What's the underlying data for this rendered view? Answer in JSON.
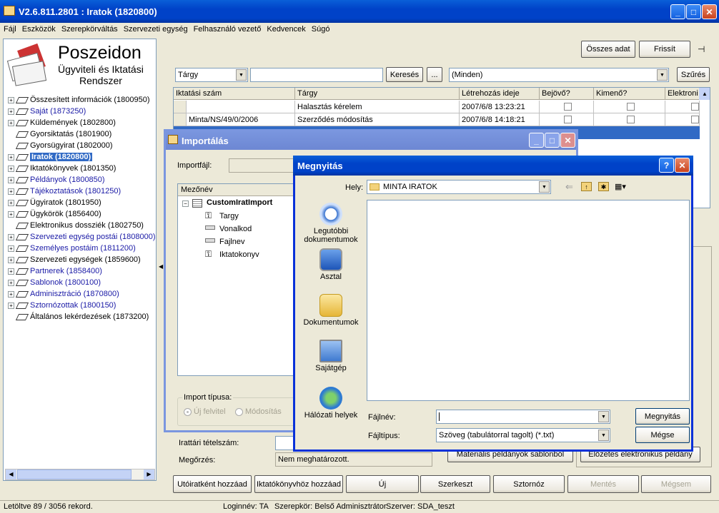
{
  "app": {
    "title": "V2.6.811.2801 : Iratok (1820800)"
  },
  "menu": [
    "Fájl",
    "Eszközök",
    "Szerepkörváltás",
    "Szervezeti egység",
    "Felhasználó vezető",
    "Kedvencek",
    "Súgó"
  ],
  "logo": {
    "line1": "Poszeidon",
    "line2": "Ügyviteli és Iktatási",
    "line3": "Rendszer"
  },
  "tree": [
    {
      "label": "Összesített információk (1800950)",
      "pm": "+",
      "blue": false
    },
    {
      "label": "Saját (1873250)",
      "pm": "+",
      "blue": true
    },
    {
      "label": "Küldemények (1802800)",
      "pm": "+",
      "blue": false
    },
    {
      "label": "Gyorsiktatás (1801900)",
      "pm": "",
      "blue": false
    },
    {
      "label": "Gyorsügyirat (1802000)",
      "pm": "",
      "blue": false
    },
    {
      "label": "Iratok (1820800)",
      "pm": "+",
      "blue": false,
      "selected": true
    },
    {
      "label": "Iktatókönyvek (1801350)",
      "pm": "+",
      "blue": false
    },
    {
      "label": "Példányok (1800850)",
      "pm": "+",
      "blue": true
    },
    {
      "label": "Tájékoztatások (1801250)",
      "pm": "+",
      "blue": true
    },
    {
      "label": "Ügyiratok (1801950)",
      "pm": "+",
      "blue": false
    },
    {
      "label": "Ügykörök (1856400)",
      "pm": "+",
      "blue": false
    },
    {
      "label": "Elektronikus dossziék (1802750)",
      "pm": "",
      "blue": false
    },
    {
      "label": "Szervezeti egység postái (1808000)",
      "pm": "+",
      "blue": true
    },
    {
      "label": "Személyes postáim (1811200)",
      "pm": "+",
      "blue": true
    },
    {
      "label": "Szervezeti egységek (1859600)",
      "pm": "+",
      "blue": false
    },
    {
      "label": "Partnerek (1858400)",
      "pm": "+",
      "blue": true
    },
    {
      "label": "Sablonok (1800100)",
      "pm": "+",
      "blue": true
    },
    {
      "label": "Adminisztráció (1870800)",
      "pm": "+",
      "blue": true
    },
    {
      "label": "Sztornózottak (1800150)",
      "pm": "+",
      "blue": true
    },
    {
      "label": "Általános lekérdezések (1873200)",
      "pm": "",
      "blue": false
    }
  ],
  "topbar": {
    "all_data": "Összes adat",
    "refresh": "Frissít"
  },
  "search": {
    "field": "Tárgy",
    "value": "",
    "search_btn": "Keresés",
    "more_btn": "...",
    "filter_value": "(Minden)",
    "filter_btn": "Szűrés"
  },
  "grid": {
    "headers": [
      "Iktatási szám",
      "Tárgy",
      "Létrehozás ideje",
      "Bejövő?",
      "Kimenő?",
      "Elektroni"
    ],
    "rows": [
      {
        "iktatasi": "",
        "targy": "Halasztás kérelem",
        "ido": "2007/6/8 13:23:21"
      },
      {
        "iktatasi": "Minta/NS/49/0/2006",
        "targy": "Szerződés módosítás",
        "ido": "2007/6/8 14:18:21"
      }
    ]
  },
  "bottom": {
    "irattari_label": "Irattári tételszám:",
    "megorzes_label": "Megőrzés:",
    "megorzes_value": "Nem meghatározott.",
    "materialis": "Materiális példányok sablonból",
    "elozetes": "Előzetes elektronikus példány",
    "buttons": [
      {
        "label": "Utóiratként hozzáad",
        "enabled": true
      },
      {
        "label": "Iktatókönyvhöz hozzáad",
        "enabled": true
      },
      {
        "label": "Új",
        "enabled": true
      },
      {
        "label": "Szerkeszt",
        "enabled": true
      },
      {
        "label": "Sztornóz",
        "enabled": true
      },
      {
        "label": "Mentés",
        "enabled": false
      },
      {
        "label": "Mégsem",
        "enabled": false
      }
    ]
  },
  "status": {
    "records": "Letöltve 89 / 3056 rekord.",
    "login": "Loginnév: TA",
    "role": "Szerepkör: Belső Adminisztrátor",
    "server": "Szerver: SDA_teszt"
  },
  "import_dialog": {
    "title": "Importálás",
    "file_label": "Importfájl:",
    "col_header": "Mezőnév",
    "root": "CustomIratImport",
    "children": [
      "Targy",
      "Vonalkod",
      "Fajlnev",
      "Iktatokonyv"
    ],
    "type_label": "Import típusa:",
    "opt_new": "Új felvitel",
    "opt_mod": "Módosítás"
  },
  "open_dialog": {
    "title": "Megnyitás",
    "location_label": "Hely:",
    "location_value": "MINTA IRATOK",
    "places": [
      {
        "label": "Legutóbbi dokumentumok",
        "icon": "recent-documents-icon"
      },
      {
        "label": "Asztal",
        "icon": "desktop-icon"
      },
      {
        "label": "Dokumentumok",
        "icon": "documents-folder-icon"
      },
      {
        "label": "Sajátgép",
        "icon": "my-computer-icon"
      },
      {
        "label": "Hálózati helyek",
        "icon": "network-places-icon"
      }
    ],
    "filename_label": "Fájlnév:",
    "filename_value": "",
    "filetype_label": "Fájltípus:",
    "filetype_value": "Szöveg (tabulátorral tagolt) (*.txt)",
    "open_btn": "Megnyitás",
    "cancel_btn": "Mégse"
  }
}
